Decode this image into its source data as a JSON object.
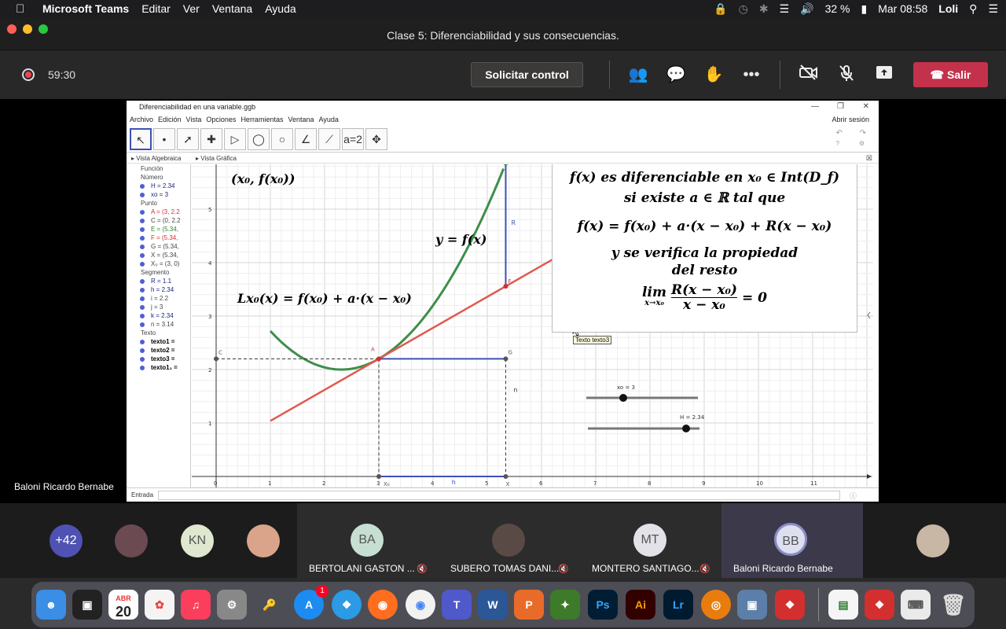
{
  "menubar": {
    "app": "Microsoft Teams",
    "items": [
      "Editar",
      "Ver",
      "Ventana",
      "Ayuda"
    ],
    "battery": "32 %",
    "clock": "Mar 08:58",
    "user": "Loli"
  },
  "window": {
    "title": "Clase 5: Diferenciabilidad y sus consecuencias."
  },
  "toolbar": {
    "timer": "59:30",
    "control_label": "Solicitar control",
    "leave_label": "Salir",
    "more_icon": "•••"
  },
  "presenter": {
    "name": "Baloni Ricardo Bernabe"
  },
  "geogebra": {
    "file_title": "Diferenciabilidad en una variable.ggb",
    "menu": [
      "Archivo",
      "Edición",
      "Vista",
      "Opciones",
      "Herramientas",
      "Ventana",
      "Ayuda"
    ],
    "session": "Abrir sesión",
    "algebra_title": "Vista Algebraica",
    "graphics_title": "Vista Gráfica",
    "input_label": "Entrada",
    "algebra": [
      {
        "type": "cat",
        "text": "Función"
      },
      {
        "type": "cat",
        "text": "Número"
      },
      {
        "type": "item",
        "text": "H = 2.34",
        "color": "#1a237e"
      },
      {
        "type": "item",
        "text": "xo = 3",
        "color": "#1a237e"
      },
      {
        "type": "cat",
        "text": "Punto"
      },
      {
        "type": "item",
        "text": "A = (3, 2.2",
        "color": "#d32f2f"
      },
      {
        "type": "item",
        "text": "C = (0, 2.2",
        "color": "#444444"
      },
      {
        "type": "item",
        "text": "E = (5.34,",
        "color": "#2e7d32"
      },
      {
        "type": "item",
        "text": "F = (5.34,",
        "color": "#d32f2f"
      },
      {
        "type": "item",
        "text": "G = (5.34,",
        "color": "#444444"
      },
      {
        "type": "item",
        "text": "X = (5.34,",
        "color": "#444444"
      },
      {
        "type": "item",
        "text": "X₀ = (3, 0)",
        "color": "#444444"
      },
      {
        "type": "cat",
        "text": "Segmento"
      },
      {
        "type": "item",
        "text": "R = 1.1",
        "color": "#1a237e"
      },
      {
        "type": "item",
        "text": "h = 2.34",
        "color": "#1a237e"
      },
      {
        "type": "item",
        "text": "i = 2.2",
        "color": "#444444"
      },
      {
        "type": "item",
        "text": "j = 3",
        "color": "#444444"
      },
      {
        "type": "item",
        "text": "k = 2.34",
        "color": "#1a237e"
      },
      {
        "type": "item",
        "text": "n = 3.14",
        "color": "#444444"
      },
      {
        "type": "cat",
        "text": "Texto"
      },
      {
        "type": "item",
        "text": "texto1 =",
        "color": "#000000"
      },
      {
        "type": "item",
        "text": "texto2 =",
        "color": "#000000"
      },
      {
        "type": "item",
        "text": "texto3 =",
        "color": "#000000"
      },
      {
        "type": "item",
        "text": "texto1₁ =",
        "color": "#000000"
      }
    ],
    "labels": {
      "point": "(x₀, f(x₀))",
      "curve": "y = f(x)",
      "tangent": "Lx₀(x) = f(x₀) + a·(x − x₀)",
      "slider_xo": "xo = 3",
      "slider_h": "H = 2.34",
      "tooltip": "Texto texto3",
      "pt_A": "A",
      "pt_C": "C",
      "pt_E": "E",
      "pt_F": "F",
      "pt_G": "G",
      "seg_R": "R",
      "seg_n": "n",
      "seg_h": "h",
      "pt_X0": "X₀",
      "pt_X": "X"
    },
    "theorem": {
      "line1": "f(x) es diferenciable en x₀ ∈ Int(D_f)",
      "line2": "si existe a ∈ ℝ tal que",
      "line3": "f(x) = f(x₀) + a·(x − x₀) + R(x − x₀)",
      "line4": "y se verifica la propiedad",
      "line5": "del resto",
      "limit_op": "lim",
      "limit_sub": "x→x₀",
      "frac_num": "R(x − x₀)",
      "frac_den": "x − x₀",
      "equals": "= 0"
    },
    "axis_x_ticks": [
      "0",
      "1",
      "2",
      "3",
      "4",
      "5",
      "6",
      "7",
      "8",
      "9",
      "10",
      "11"
    ],
    "axis_y_ticks": [
      "1",
      "2",
      "3",
      "4",
      "5"
    ]
  },
  "participants": {
    "more": "+42",
    "tiles": [
      {
        "initials": "KN",
        "name": ""
      },
      {
        "initials": "BA",
        "name": "BERTOLANI GASTON ..."
      },
      {
        "initials": "",
        "name": "SUBERO TOMAS DANI..."
      },
      {
        "initials": "MT",
        "name": "MONTERO SANTIAGO..."
      },
      {
        "initials": "BB",
        "name": "Baloni Ricardo Bernabe"
      }
    ]
  },
  "dock": {
    "calendar_month": "ABR",
    "calendar_day": "20",
    "appstore_badge": "1",
    "icons": [
      "Ps",
      "Ai",
      "Lr"
    ]
  }
}
